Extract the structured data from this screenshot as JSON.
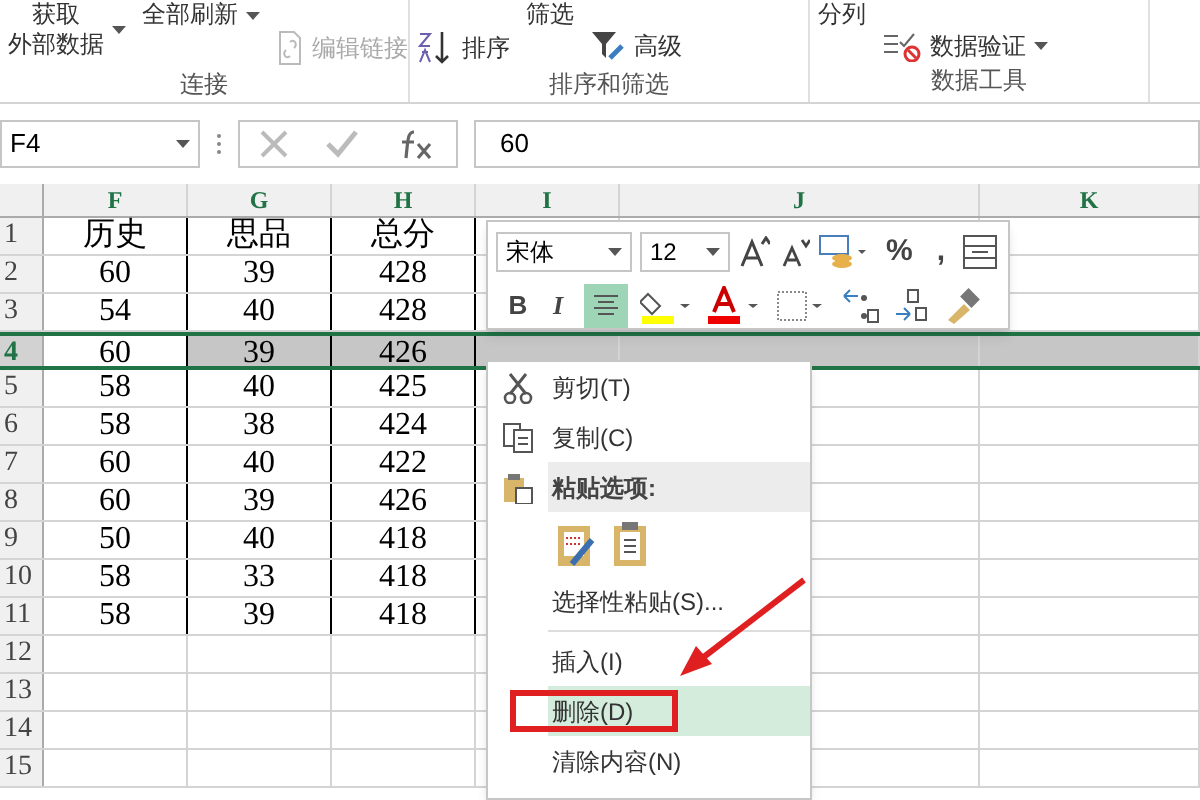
{
  "ribbon": {
    "groups": [
      {
        "label": "连接",
        "items": [
          {
            "kind": "large",
            "label_lines": [
              "获取",
              "外部数据"
            ],
            "disabled": false,
            "dropdown": true
          },
          {
            "kind": "large",
            "label_lines": [
              "全部刷新"
            ],
            "disabled": false,
            "dropdown": true
          },
          {
            "kind": "small",
            "label_lines": [
              "编辑链接"
            ],
            "disabled": true,
            "dropdown": false
          }
        ]
      },
      {
        "label": "排序和筛选",
        "items": [
          {
            "kind": "sort",
            "label_lines": [
              "排序"
            ],
            "disabled": false,
            "dropdown": false
          },
          {
            "kind": "large",
            "label_lines": [
              "筛选"
            ],
            "disabled": false,
            "dropdown": false
          },
          {
            "kind": "filter",
            "label_lines": [
              "高级"
            ],
            "disabled": false,
            "dropdown": false
          }
        ]
      },
      {
        "label": "数据工具",
        "items": [
          {
            "kind": "large",
            "label_lines": [
              "分列"
            ],
            "disabled": false,
            "dropdown": false
          },
          {
            "kind": "validation",
            "label_lines": [
              "数据验证"
            ],
            "disabled": false,
            "dropdown": true
          }
        ]
      }
    ]
  },
  "formula_bar": {
    "name_box": "F4",
    "value": "60"
  },
  "sheet": {
    "columns": [
      "F",
      "G",
      "H",
      "I",
      "J",
      "K"
    ],
    "rows": [
      {
        "label": "1",
        "selected": false,
        "cells": [
          "历史",
          "思品",
          "总分"
        ]
      },
      {
        "label": "2",
        "selected": false,
        "cells": [
          "60",
          "39",
          "428"
        ]
      },
      {
        "label": "3",
        "selected": false,
        "cells": [
          "54",
          "40",
          "428"
        ]
      },
      {
        "label": "4",
        "selected": true,
        "cells": [
          "60",
          "39",
          "426"
        ]
      },
      {
        "label": "5",
        "selected": false,
        "cells": [
          "58",
          "40",
          "425"
        ]
      },
      {
        "label": "6",
        "selected": false,
        "cells": [
          "58",
          "38",
          "424"
        ]
      },
      {
        "label": "7",
        "selected": false,
        "cells": [
          "60",
          "40",
          "422"
        ]
      },
      {
        "label": "8",
        "selected": false,
        "cells": [
          "60",
          "39",
          "426"
        ]
      },
      {
        "label": "9",
        "selected": false,
        "cells": [
          "50",
          "40",
          "418"
        ]
      },
      {
        "label": "10",
        "selected": false,
        "cells": [
          "58",
          "33",
          "418"
        ]
      },
      {
        "label": "11",
        "selected": false,
        "cells": [
          "58",
          "39",
          "418"
        ]
      },
      {
        "label": "12",
        "selected": false,
        "cells": []
      },
      {
        "label": "13",
        "selected": false,
        "cells": []
      },
      {
        "label": "14",
        "selected": false,
        "cells": []
      },
      {
        "label": "15",
        "selected": false,
        "cells": []
      }
    ]
  },
  "mini_toolbar": {
    "font": "宋体",
    "size": "12",
    "bold": "B",
    "italic": "I",
    "percent": "%",
    "comma": ",",
    "center_aligned": true
  },
  "context_menu": {
    "items": [
      {
        "kind": "cut",
        "label": "剪切(T)",
        "selected": false,
        "marked": false
      },
      {
        "kind": "copy",
        "label": "复制(C)",
        "selected": false,
        "marked": false
      },
      {
        "kind": "paste_header",
        "label": "粘贴选项:"
      },
      {
        "kind": "paste_icons"
      },
      {
        "kind": "item",
        "label": "选择性粘贴(S)...",
        "selected": false,
        "marked": false
      },
      {
        "kind": "separator"
      },
      {
        "kind": "item",
        "label": "插入(I)",
        "selected": false,
        "marked": false
      },
      {
        "kind": "item",
        "label": "删除(D)",
        "selected": true,
        "marked": true
      },
      {
        "kind": "item",
        "label": "清除内容(N)",
        "selected": false,
        "marked": false
      }
    ]
  }
}
